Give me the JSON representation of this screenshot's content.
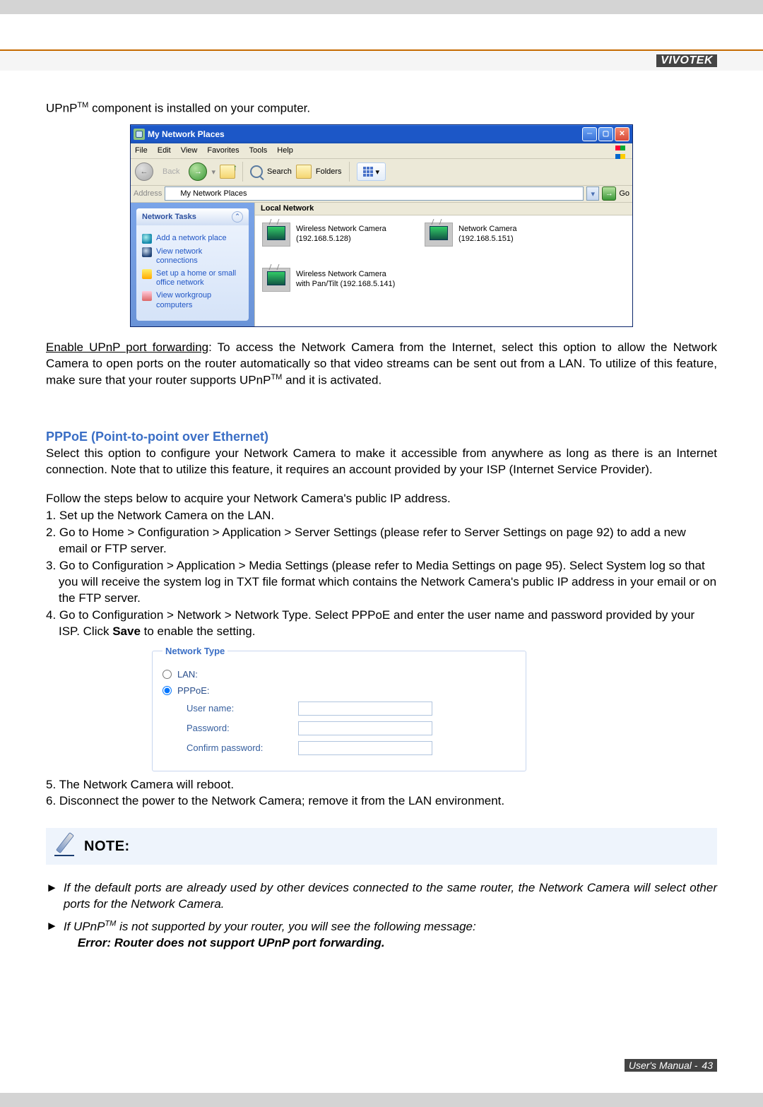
{
  "brand": "VIVOTEK",
  "intro_html": "UPnP<sup>TM</sup> component is installed on your computer.",
  "explorer": {
    "title": "My Network Places",
    "menu": [
      "File",
      "Edit",
      "View",
      "Favorites",
      "Tools",
      "Help"
    ],
    "toolbar": {
      "back": "Back",
      "search": "Search",
      "folders": "Folders"
    },
    "address_label": "Address",
    "address_value": "My Network Places",
    "go": "Go",
    "sidepanel": {
      "header": "Network Tasks",
      "items": [
        "Add a network place",
        "View network connections",
        "Set up a home or small office network",
        "View workgroup computers"
      ]
    },
    "main": {
      "column_header": "Local Network",
      "items": [
        "Wireless Network Camera (192.168.5.128)",
        "Network Camera (192.168.5.151)",
        "Wireless Network Camera with Pan/Tilt (192.168.5.141)"
      ]
    }
  },
  "upnp_paragraph_html": "<span class=\"underline\">Enable UPnP port forwarding</span>: To access the Network Camera from the Internet, select this option to allow the Network Camera to open ports on the router automatically so that video streams can be sent out from a LAN. To utilize of this feature, make sure that your router supports UPnP<sup>TM</sup> and it is activated.",
  "pppoe": {
    "title": "PPPoE (Point-to-point over Ethernet)",
    "intro": "Select this option to configure your Network Camera to make it accessible from anywhere as long as there is an Internet connection. Note that to utilize this feature, it requires an account provided by your ISP (Internet Service Provider).",
    "steps_lead": "Follow the steps below to acquire your Network Camera's public IP address.",
    "steps": [
      "1. Set up the Network Camera on the LAN.",
      "2. Go to Home > Configuration > Application > Server Settings (please refer to Server Settings on page 92) to add a new email or FTP server.",
      "3. Go to Configuration > Application > Media Settings (please refer to Media Settings on page 95). Select System log so that you will receive the system log in TXT file format which contains the Network Camera's public IP address in your email or on the FTP server.",
      "4. Go to Configuration > Network > Network Type. Select PPPoE and enter the user name and password provided by your ISP. Click Save to enable the setting."
    ],
    "after_steps": [
      "5. The Network Camera will reboot.",
      "6. Disconnect the power to the Network Camera; remove it from the LAN environment."
    ]
  },
  "nettype": {
    "legend": "Network Type",
    "lan": "LAN:",
    "pppoe": "PPPoE:",
    "user": "User name:",
    "pass": "Password:",
    "confirm": "Confirm password:"
  },
  "note": {
    "label": "NOTE:",
    "bullets": [
      "If the default ports are already used by other devices connected to the same router, the Network Camera will select other ports for the Network Camera.",
      "If UPnP<sup>TM</sup> is not supported by your router, you will see the following message:",
      "Error: Router does not support UPnP port forwarding."
    ]
  },
  "footer": {
    "label": "User's Manual -",
    "page": "43"
  }
}
